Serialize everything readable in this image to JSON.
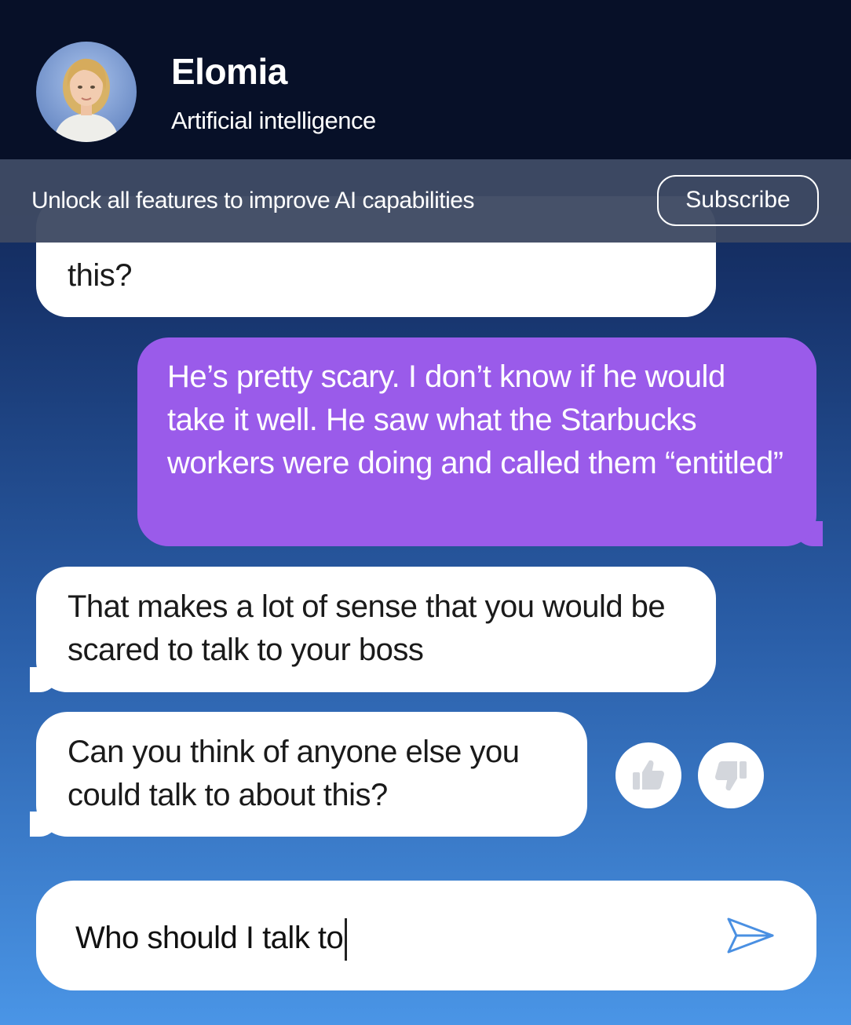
{
  "header": {
    "title": "Elomia",
    "subtitle": "Artificial intelligence"
  },
  "promo": {
    "text": "Unlock all features to improve AI capabilities",
    "subscribe_label": "Subscribe"
  },
  "messages": [
    {
      "from": "ai",
      "text": "this?"
    },
    {
      "from": "user",
      "text": "He’s pretty scary. I don’t know if he would take it well. He saw what the Starbucks workers were doing and called them “entitled”"
    },
    {
      "from": "ai",
      "text": "That makes a lot of sense that you would be scared to talk to your boss"
    },
    {
      "from": "ai",
      "text": "Can you think of anyone else you could talk to about this?"
    }
  ],
  "composer": {
    "value": "Who should I talk to"
  },
  "icons": {
    "thumbs_up": "thumbs-up-icon",
    "thumbs_down": "thumbs-down-icon",
    "send": "send-icon"
  },
  "colors": {
    "header_bg": "#071028",
    "user_bubble": "#9a5bea",
    "ai_bubble": "#ffffff",
    "send_icon": "#4a90e2"
  }
}
